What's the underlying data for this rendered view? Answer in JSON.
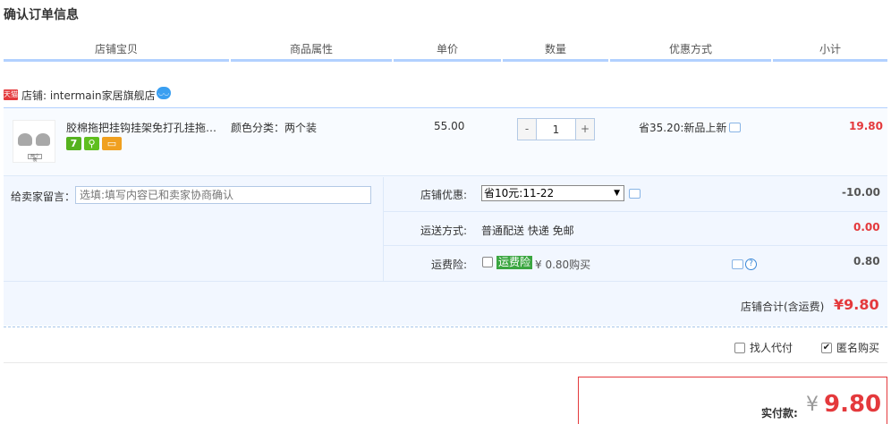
{
  "page": {
    "title": "确认订单信息"
  },
  "columns": [
    "店铺宝贝",
    "商品属性",
    "单价",
    "数量",
    "优惠方式",
    "小计"
  ],
  "shop": {
    "badge": "天猫",
    "label": "店铺: intermain家居旗舰店",
    "wangwang_icon": "wangwang-chat-icon"
  },
  "item": {
    "thumb_caption": "两个装",
    "title": "胶棉拖把挂钩挂架免打孔挂拖把...",
    "sku": "颜色分类：两个装",
    "service_icons": [
      {
        "name": "seven-day-return-icon",
        "text": "7"
      },
      {
        "name": "guarantee-icon",
        "text": "⚲"
      },
      {
        "name": "credit-card-icon",
        "text": "▭"
      }
    ],
    "unit_price": "55.00",
    "qty_minus": "-",
    "qty_value": "1",
    "qty_plus": "+",
    "discount": "省35.20:新品上新",
    "subtotal": "19.80"
  },
  "memo": {
    "label": "给卖家留言：",
    "placeholder": "选填:填写内容已和卖家协商确认"
  },
  "coupon": {
    "label": "店铺优惠:",
    "selected": "省10元:11-22",
    "amount": "-10.00"
  },
  "shipping": {
    "label": "运送方式:",
    "value": "普通配送 快递 免邮",
    "amount": "0.00"
  },
  "insurance": {
    "label": "运费险:",
    "badge": "运费险",
    "price": "¥ 0.80购买",
    "amount": "0.80",
    "help_text": "?"
  },
  "shop_total": {
    "label": "店铺合计(含运费)",
    "amount": "¥9.80"
  },
  "options": {
    "proxy_label": "找人代付",
    "proxy_checked": false,
    "anon_label": "匿名购买",
    "anon_checked": true,
    "check_mark": "✔"
  },
  "payment": {
    "label": "实付款:",
    "currency": "¥",
    "amount": "9.80"
  },
  "colors": {
    "accent_red": "#e4393c",
    "header_rule": "#b2d1ff",
    "block_bg": "#f2f7ff"
  }
}
